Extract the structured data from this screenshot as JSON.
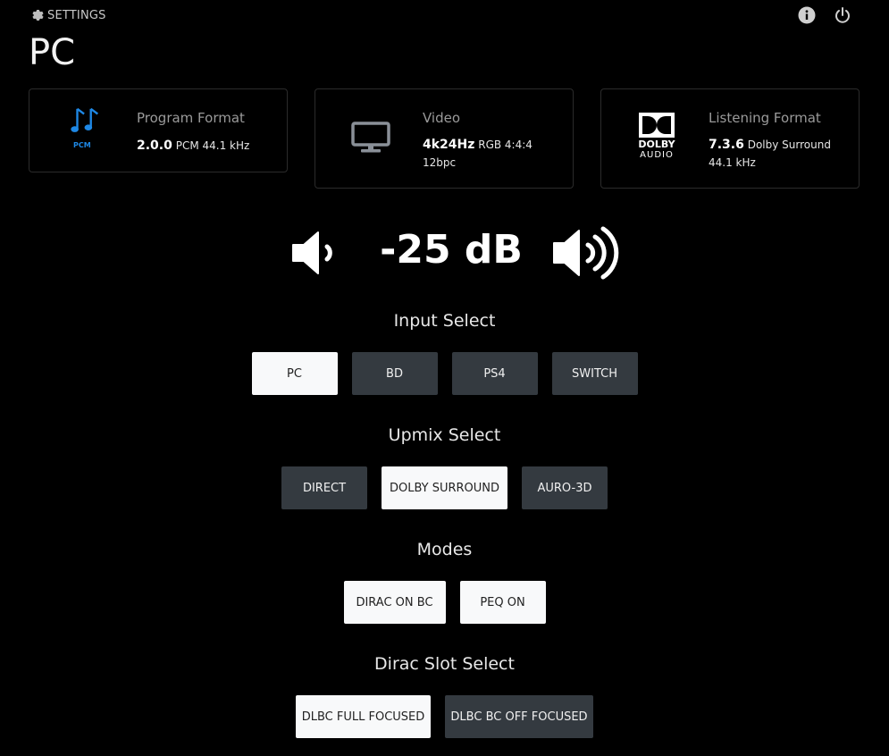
{
  "header": {
    "settings_label": "SETTINGS",
    "page_title": "PC"
  },
  "cards": {
    "program": {
      "title": "Program Format",
      "icon_badge": "PCM",
      "value_bold": "2.0.0",
      "value_rest": "PCM 44.1 kHz"
    },
    "video": {
      "title": "Video",
      "value_bold": "4k24Hz",
      "value_rest": "RGB 4:4:4",
      "line2": "12bpc"
    },
    "listening": {
      "title": "Listening Format",
      "logo_top": "DOLBY",
      "logo_bottom": "AUDIO",
      "value_bold": "7.3.6",
      "value_rest": "Dolby Surround",
      "line2": "44.1 kHz"
    }
  },
  "volume": {
    "value": "-25 dB"
  },
  "input_select": {
    "title": "Input Select",
    "buttons": [
      "PC",
      "BD",
      "PS4",
      "SWITCH"
    ]
  },
  "upmix_select": {
    "title": "Upmix Select",
    "buttons": [
      "DIRECT",
      "DOLBY SURROUND",
      "AURO-3D"
    ]
  },
  "modes": {
    "title": "Modes",
    "buttons": [
      "DIRAC ON BC",
      "PEQ ON"
    ]
  },
  "dirac_slot": {
    "title": "Dirac Slot Select",
    "buttons": [
      "DLBC FULL FOCUSED",
      "DLBC BC OFF FOCUSED"
    ]
  },
  "colors": {
    "background": "#000000",
    "button_inactive": "#343a40",
    "button_active": "#f8f9fa",
    "pcm_blue": "#1e88e5"
  },
  "icons": [
    "gear-icon",
    "info-icon",
    "power-icon",
    "music-note-icon",
    "monitor-icon",
    "dolby-logo-icon",
    "volume-down-icon",
    "volume-up-icon"
  ]
}
